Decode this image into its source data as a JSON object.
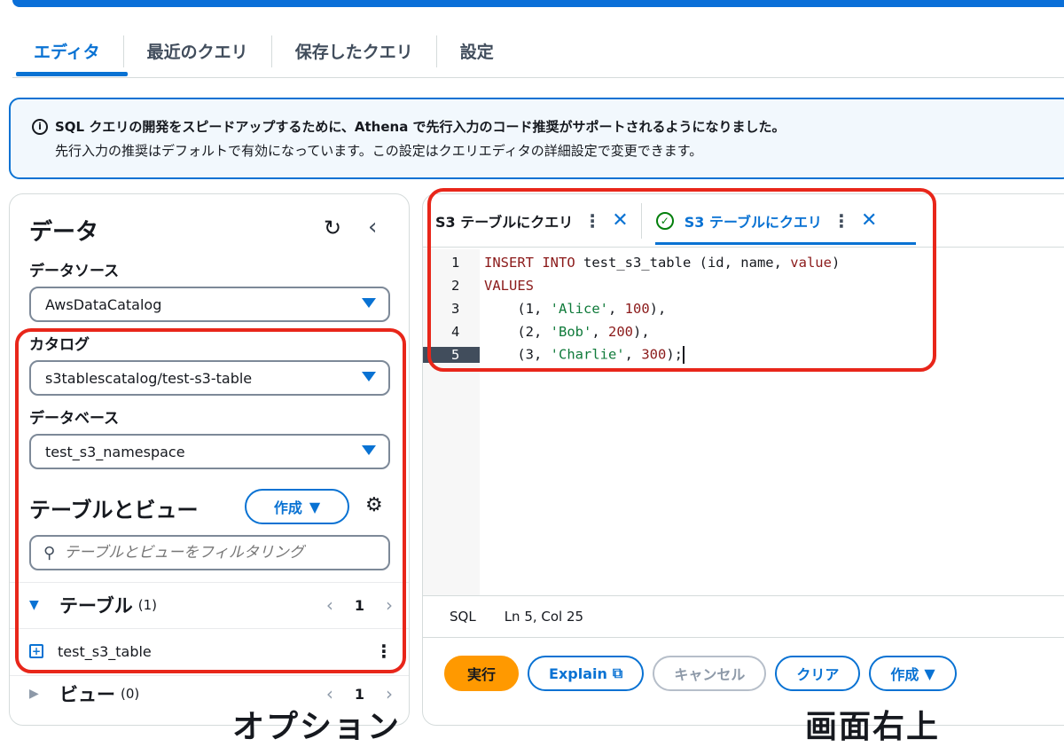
{
  "tabs": [
    "エディタ",
    "最近のクエリ",
    "保存したクエリ",
    "設定"
  ],
  "info": {
    "line1": "SQL クエリの開発をスピードアップするために、Athena で先行入力のコード推奨がサポートされるようになりました。",
    "line2": "先行入力の推奨はデフォルトで有効になっています。この設定はクエリエディタの詳細設定で変更できます。"
  },
  "data_panel": {
    "title": "データ",
    "datasource_label": "データソース",
    "datasource_value": "AwsDataCatalog",
    "catalog_label": "カタログ",
    "catalog_value": "s3tablescatalog/test-s3-table",
    "database_label": "データベース",
    "database_value": "test_s3_namespace",
    "tables_views_title": "テーブルとビュー",
    "create_label": "作成",
    "filter_placeholder": "テーブルとビューをフィルタリング",
    "tables_group": {
      "name": "テーブル",
      "count": "(1)",
      "page": "1"
    },
    "table_item": "test_s3_table",
    "views_group": {
      "name": "ビュー",
      "count": "(0)",
      "page": "1"
    }
  },
  "query_tabs": [
    {
      "label": "S3 テーブルにクエリ"
    },
    {
      "label": "S3 テーブルにクエリ"
    }
  ],
  "editor": {
    "line_numbers": [
      "1",
      "2",
      "3",
      "4",
      "5"
    ]
  },
  "status": {
    "lang": "SQL",
    "position": "Ln 5, Col 25"
  },
  "actions": {
    "run": "実行",
    "explain": "Explain",
    "cancel": "キャンセル",
    "clear": "クリア",
    "create": "作成"
  },
  "bottom_text": "オプション　　　　　　　　　　　　画面右上",
  "colors": {
    "accent": "#0972d3",
    "highlight": "#e8261a",
    "run_button": "#ff9900"
  }
}
